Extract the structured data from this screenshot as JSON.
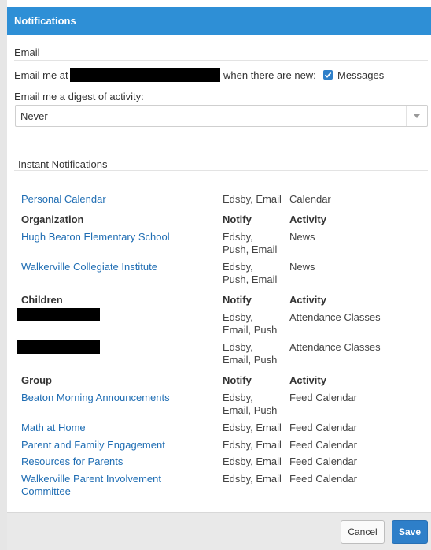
{
  "header": {
    "title": "Notifications"
  },
  "email": {
    "section_label": "Email",
    "prefix": "Email me at",
    "suffix": "when there are new:",
    "messages_label": "Messages",
    "messages_checked": true,
    "digest_label": "Email me a digest of activity:",
    "digest_value": "Never"
  },
  "instant": {
    "section_label": "Instant Notifications",
    "calendar_row": {
      "name": "Personal Calendar",
      "notify": "Edsby, Email",
      "activity": "Calendar"
    },
    "organization": {
      "header": {
        "name": "Organization",
        "notify": "Notify",
        "activity": "Activity"
      },
      "rows": [
        {
          "name": "Hugh Beaton Elementary School",
          "notify_line1": "Edsby,",
          "notify_line2": "Push, Email",
          "activity": "News"
        },
        {
          "name": "Walkerville Collegiate Institute",
          "notify_line1": "Edsby,",
          "notify_line2": "Push, Email",
          "activity": "News"
        }
      ]
    },
    "children": {
      "header": {
        "name": "Children",
        "notify": "Notify",
        "activity": "Activity"
      },
      "rows": [
        {
          "notify_line1": "Edsby,",
          "notify_line2": "Email, Push",
          "activity": "Attendance Classes"
        },
        {
          "notify_line1": "Edsby,",
          "notify_line2": "Email, Push",
          "activity": "Attendance Classes"
        }
      ]
    },
    "group": {
      "header": {
        "name": "Group",
        "notify": "Notify",
        "activity": "Activity"
      },
      "rows": [
        {
          "name": "Beaton Morning Announcements",
          "notify_line1": "Edsby,",
          "notify_line2": "Email, Push",
          "activity": "Feed Calendar"
        },
        {
          "name": "Math at Home",
          "notify": "Edsby, Email",
          "activity": "Feed Calendar"
        },
        {
          "name": "Parent and Family Engagement",
          "notify": "Edsby, Email",
          "activity": "Feed Calendar"
        },
        {
          "name": "Resources for Parents",
          "notify": "Edsby, Email",
          "activity": "Feed Calendar"
        },
        {
          "name_line1": "Walkerville Parent Involvement",
          "name_line2": "Committee",
          "notify": "Edsby, Email",
          "activity": "Feed Calendar"
        }
      ]
    }
  },
  "footer": {
    "cancel_label": "Cancel",
    "save_label": "Save"
  },
  "colors": {
    "header": "#2e8fd6",
    "link": "#1f6db3",
    "primary_button": "#2e7fc9"
  }
}
